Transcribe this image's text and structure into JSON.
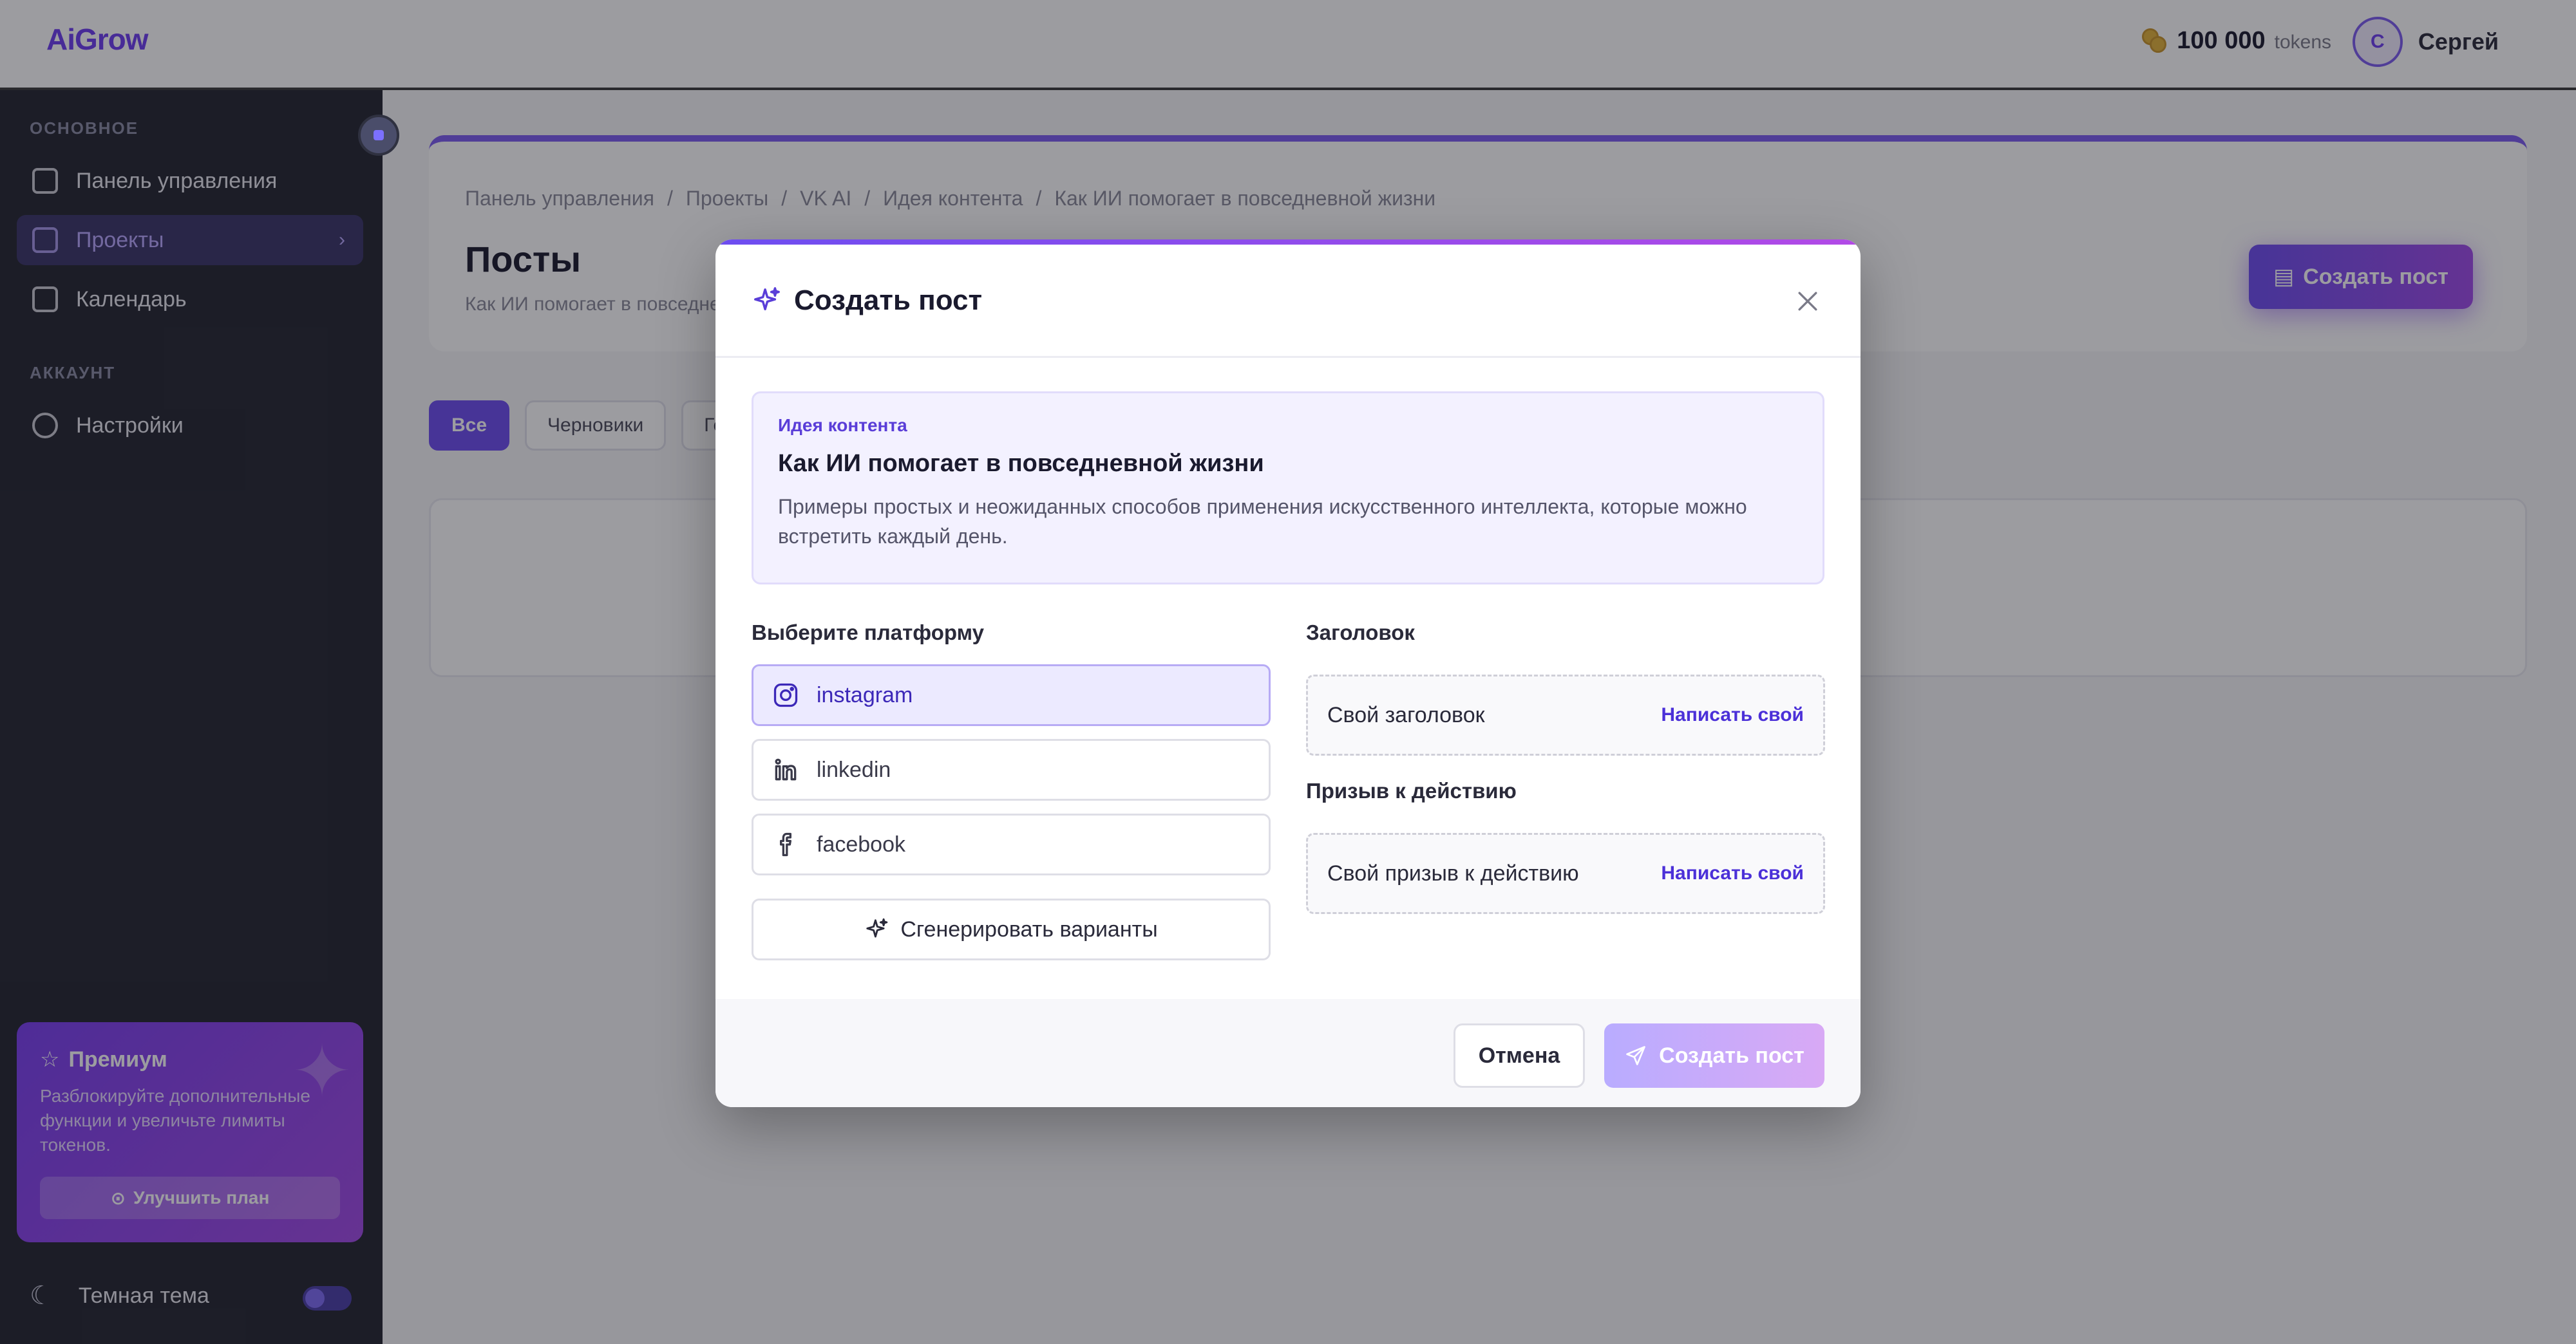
{
  "app": {
    "logo": "AiGrow"
  },
  "header": {
    "tokens_value": "100 000",
    "tokens_unit": "tokens",
    "user_initial": "С",
    "user_name": "Сергей"
  },
  "sidebar": {
    "section_main": "ОСНОВНОЕ",
    "items": [
      {
        "label": "Панель управления",
        "icon": "dashboard-icon"
      },
      {
        "label": "Проекты",
        "icon": "folder-icon",
        "active": true
      },
      {
        "label": "Календарь",
        "icon": "calendar-icon"
      }
    ],
    "section_account": "АККАУНТ",
    "settings_label": "Настройки",
    "premium": {
      "title": "Премиум",
      "text": "Разблокируйте дополнительные функции и увеличьте лимиты токенов.",
      "button": "Улучшить план"
    },
    "theme_label": "Темная тема"
  },
  "page": {
    "breadcrumbs": [
      "Панель управления",
      "/",
      "Проекты",
      "/",
      "VK AI",
      "/",
      "Идея контента",
      "/",
      "Как ИИ помогает в повседневной жизни"
    ],
    "title": "Посты",
    "subtitle": "Как ИИ помогает в повседневной жизни",
    "create_button": "Создать пост",
    "filters": [
      "Все",
      "Черновики",
      "Ге"
    ]
  },
  "modal": {
    "title": "Создать пост",
    "idea": {
      "label": "Идея контента",
      "title": "Как ИИ помогает в повседневной жизни",
      "description": "Примеры простых и неожиданных способов применения искусственного интеллекта, которые можно встретить каждый день."
    },
    "platform_label": "Выберите платформу",
    "platforms": [
      {
        "label": "instagram",
        "icon": "instagram-icon",
        "selected": true
      },
      {
        "label": "linkedin",
        "icon": "linkedin-icon",
        "selected": false
      },
      {
        "label": "facebook",
        "icon": "facebook-icon",
        "selected": false
      }
    ],
    "generate_button": "Сгенерировать варианты",
    "headline_label": "Заголовок",
    "headline_value": "Свой заголовок",
    "headline_link": "Написать свой",
    "cta_label": "Призыв к действию",
    "cta_value": "Свой призыв к действию",
    "cta_link": "Написать свой",
    "cancel_button": "Отмена",
    "create_button": "Создать пост"
  },
  "colors": {
    "accent": "#6d4df0",
    "accent_gradient_end": "#b24ae6",
    "sidebar_bg": "#232530",
    "overlay": "rgba(20,20,28,0.42)"
  }
}
